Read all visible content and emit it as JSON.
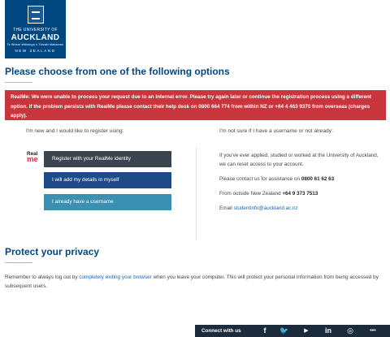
{
  "logo": {
    "line1": "THE UNIVERSITY OF",
    "line2": "AUCKLAND",
    "line3": "Te Whare Wānanga o Tāmaki Makaurau",
    "line4": "NEW ZEALAND"
  },
  "page_title": "Please choose from one of the following options",
  "error_message": "RealMe: We were unable to process your request due to an internal error. Please try again later or continue the registration process using a different option. If the problem persists with RealMe please contact their help desk on 0800 664 774 from within NZ or +64 4 463 9370 from overseas (charges apply).",
  "left": {
    "lead": "I'm new and I would like to register using:",
    "realme_logo_top": "Real",
    "realme_logo_bottom": "me",
    "buttons": {
      "realme": "Register with your RealMe identity",
      "manual": "I will add my details in myself",
      "username": "I already have a username"
    }
  },
  "right": {
    "lead": "I'm not sure if I have a username or not already:",
    "p1": "If you've ever applied, studied or worked at the University of Auckland, we can reset access to your account.",
    "p2_prefix": "Please contact us for assistance on ",
    "p2_phone": "0800 61 62 63",
    "p3_prefix": "From outside New Zealand ",
    "p3_phone": "+64 9 373 7513",
    "p4_prefix": "Email ",
    "p4_email": "studentinfo@auckland.ac.nz"
  },
  "privacy": {
    "title": "Protect your privacy",
    "text_before": "Remember to always log out by ",
    "link": "completely exiting your browser",
    "text_after": " when you leave your computer. This will protect your personal information from being accessed by subsequent users."
  },
  "footer": {
    "connect": "Connect with us",
    "icons": [
      "facebook-icon",
      "twitter-icon",
      "youtube-icon",
      "linkedin-icon",
      "instagram-icon",
      "flickr-icon"
    ],
    "glyphs": {
      "facebook": "f",
      "twitter": "🐦",
      "youtube": "▶",
      "linkedin": "in",
      "instagram": "◎",
      "more": "•••"
    }
  },
  "colors": {
    "brand_blue": "#00467f",
    "error_red": "#c9353d",
    "realme_button": "#3b4551",
    "manual_button": "#1c4b88",
    "username_button": "#3b8fb0",
    "link_blue": "#1565c0",
    "footer_bg": "#1c2b3b"
  }
}
